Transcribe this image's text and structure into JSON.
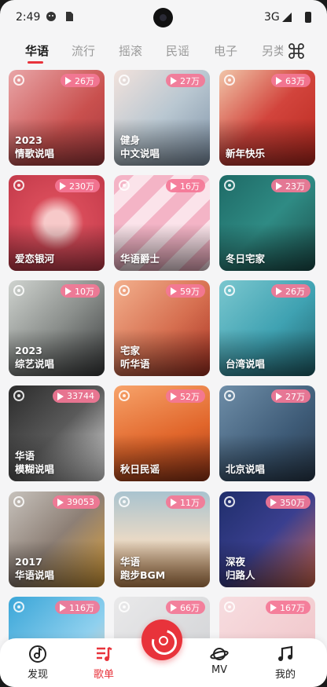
{
  "status_bar": {
    "time": "2:49",
    "network": "3G"
  },
  "tabs": [
    "华语",
    "流行",
    "摇滚",
    "民谣",
    "电子",
    "另类"
  ],
  "playlists": [
    {
      "title": "2023\n情歌说唱",
      "plays": "26万",
      "bg": "linear-gradient(135deg,#e9a6a8,#c9504e 60%,#a83a3e)"
    },
    {
      "title": "健身\n中文说唱",
      "plays": "27万",
      "bg": "linear-gradient(135deg,#f2e2dc,#b9c7d1 50%,#7f93a8)"
    },
    {
      "title": "新年快乐",
      "plays": "63万",
      "bg": "linear-gradient(135deg,#f1c6a9,#d2443c 50%,#b8281e)"
    },
    {
      "title": "爱恋银河",
      "plays": "230万",
      "bg": "radial-gradient(circle at 50% 50%,#f7c9c9 0 18%,#d84b59 40%,#c33a4a 100%)"
    },
    {
      "title": "华语爵士",
      "plays": "16万",
      "bg": "repeating-linear-gradient(135deg,#f4b4c6 0 18px,#fbe3ea 18px 36px)"
    },
    {
      "title": "冬日宅家",
      "plays": "23万",
      "bg": "linear-gradient(135deg,#1e6a66,#2f8b84 50%,#1b4f4c)"
    },
    {
      "title": "2023\n综艺说唱",
      "plays": "10万",
      "bg": "linear-gradient(135deg,#cfd3cf,#8b8f8c 50%,#3a3c3d)"
    },
    {
      "title": "宅家\n听华语",
      "plays": "59万",
      "bg": "linear-gradient(135deg,#f3b08d,#d66f50 55%,#a83122)"
    },
    {
      "title": "台湾说唱",
      "plays": "26万",
      "bg": "linear-gradient(135deg,#7bc7cf,#3fa2b2 55%,#20636e)"
    },
    {
      "title": "华语\n模糊说唱",
      "plays": "33744",
      "bg": "linear-gradient(135deg,#2b2b2b,#5a5a5a 50%,#e8e8e8)"
    },
    {
      "title": "秋日民谣",
      "plays": "52万",
      "bg": "linear-gradient(160deg,#f7a36a,#e1662b 55%,#9a3516)"
    },
    {
      "title": "北京说唱",
      "plays": "27万",
      "bg": "linear-gradient(135deg,#6f8ea8,#3e5b77 60%,#2a3b4e)"
    },
    {
      "title": "2017\n华语说唱",
      "plays": "39053",
      "bg": "linear-gradient(135deg,#c7c2bc,#8d7f75 50%,#e0a33a)"
    },
    {
      "title": "华语\n跑步BGM",
      "plays": "11万",
      "bg": "linear-gradient(180deg,#a9c3cf,#e8d9c6 50%,#c98e55)"
    },
    {
      "title": "深夜\n归路人",
      "plays": "350万",
      "bg": "linear-gradient(135deg,#1f2e6b,#3a3f8f 50%,#d86a4e)"
    },
    {
      "title": "",
      "plays": "116万",
      "bg": "linear-gradient(135deg,#3aa6d8,#8fd0ee 60%,#f2d2b8)"
    },
    {
      "title": "",
      "plays": "66万",
      "bg": "linear-gradient(135deg,#e9e9ea,#cfd0d3)"
    },
    {
      "title": "",
      "plays": "167万",
      "bg": "linear-gradient(135deg,#f7dde0,#efc1c5)"
    }
  ],
  "bottom_nav": [
    {
      "label": "发现",
      "icon": "discover-icon"
    },
    {
      "label": "歌单",
      "icon": "playlist-icon"
    },
    {
      "label": "MV",
      "icon": "planet-icon"
    },
    {
      "label": "我的",
      "icon": "music-note-icon"
    }
  ],
  "colors": {
    "accent": "#e8333b",
    "badge": "#f47796"
  }
}
